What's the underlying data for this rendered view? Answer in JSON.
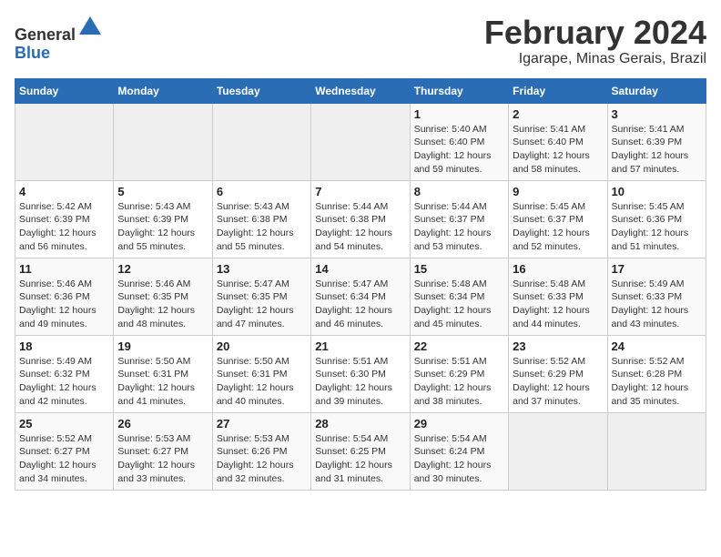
{
  "header": {
    "logo_line1": "General",
    "logo_line2": "Blue",
    "title": "February 2024",
    "subtitle": "Igarape, Minas Gerais, Brazil"
  },
  "weekdays": [
    "Sunday",
    "Monday",
    "Tuesday",
    "Wednesday",
    "Thursday",
    "Friday",
    "Saturday"
  ],
  "weeks": [
    [
      {
        "day": "",
        "info": ""
      },
      {
        "day": "",
        "info": ""
      },
      {
        "day": "",
        "info": ""
      },
      {
        "day": "",
        "info": ""
      },
      {
        "day": "1",
        "info": "Sunrise: 5:40 AM\nSunset: 6:40 PM\nDaylight: 12 hours\nand 59 minutes."
      },
      {
        "day": "2",
        "info": "Sunrise: 5:41 AM\nSunset: 6:40 PM\nDaylight: 12 hours\nand 58 minutes."
      },
      {
        "day": "3",
        "info": "Sunrise: 5:41 AM\nSunset: 6:39 PM\nDaylight: 12 hours\nand 57 minutes."
      }
    ],
    [
      {
        "day": "4",
        "info": "Sunrise: 5:42 AM\nSunset: 6:39 PM\nDaylight: 12 hours\nand 56 minutes."
      },
      {
        "day": "5",
        "info": "Sunrise: 5:43 AM\nSunset: 6:39 PM\nDaylight: 12 hours\nand 55 minutes."
      },
      {
        "day": "6",
        "info": "Sunrise: 5:43 AM\nSunset: 6:38 PM\nDaylight: 12 hours\nand 55 minutes."
      },
      {
        "day": "7",
        "info": "Sunrise: 5:44 AM\nSunset: 6:38 PM\nDaylight: 12 hours\nand 54 minutes."
      },
      {
        "day": "8",
        "info": "Sunrise: 5:44 AM\nSunset: 6:37 PM\nDaylight: 12 hours\nand 53 minutes."
      },
      {
        "day": "9",
        "info": "Sunrise: 5:45 AM\nSunset: 6:37 PM\nDaylight: 12 hours\nand 52 minutes."
      },
      {
        "day": "10",
        "info": "Sunrise: 5:45 AM\nSunset: 6:36 PM\nDaylight: 12 hours\nand 51 minutes."
      }
    ],
    [
      {
        "day": "11",
        "info": "Sunrise: 5:46 AM\nSunset: 6:36 PM\nDaylight: 12 hours\nand 49 minutes."
      },
      {
        "day": "12",
        "info": "Sunrise: 5:46 AM\nSunset: 6:35 PM\nDaylight: 12 hours\nand 48 minutes."
      },
      {
        "day": "13",
        "info": "Sunrise: 5:47 AM\nSunset: 6:35 PM\nDaylight: 12 hours\nand 47 minutes."
      },
      {
        "day": "14",
        "info": "Sunrise: 5:47 AM\nSunset: 6:34 PM\nDaylight: 12 hours\nand 46 minutes."
      },
      {
        "day": "15",
        "info": "Sunrise: 5:48 AM\nSunset: 6:34 PM\nDaylight: 12 hours\nand 45 minutes."
      },
      {
        "day": "16",
        "info": "Sunrise: 5:48 AM\nSunset: 6:33 PM\nDaylight: 12 hours\nand 44 minutes."
      },
      {
        "day": "17",
        "info": "Sunrise: 5:49 AM\nSunset: 6:33 PM\nDaylight: 12 hours\nand 43 minutes."
      }
    ],
    [
      {
        "day": "18",
        "info": "Sunrise: 5:49 AM\nSunset: 6:32 PM\nDaylight: 12 hours\nand 42 minutes."
      },
      {
        "day": "19",
        "info": "Sunrise: 5:50 AM\nSunset: 6:31 PM\nDaylight: 12 hours\nand 41 minutes."
      },
      {
        "day": "20",
        "info": "Sunrise: 5:50 AM\nSunset: 6:31 PM\nDaylight: 12 hours\nand 40 minutes."
      },
      {
        "day": "21",
        "info": "Sunrise: 5:51 AM\nSunset: 6:30 PM\nDaylight: 12 hours\nand 39 minutes."
      },
      {
        "day": "22",
        "info": "Sunrise: 5:51 AM\nSunset: 6:29 PM\nDaylight: 12 hours\nand 38 minutes."
      },
      {
        "day": "23",
        "info": "Sunrise: 5:52 AM\nSunset: 6:29 PM\nDaylight: 12 hours\nand 37 minutes."
      },
      {
        "day": "24",
        "info": "Sunrise: 5:52 AM\nSunset: 6:28 PM\nDaylight: 12 hours\nand 35 minutes."
      }
    ],
    [
      {
        "day": "25",
        "info": "Sunrise: 5:52 AM\nSunset: 6:27 PM\nDaylight: 12 hours\nand 34 minutes."
      },
      {
        "day": "26",
        "info": "Sunrise: 5:53 AM\nSunset: 6:27 PM\nDaylight: 12 hours\nand 33 minutes."
      },
      {
        "day": "27",
        "info": "Sunrise: 5:53 AM\nSunset: 6:26 PM\nDaylight: 12 hours\nand 32 minutes."
      },
      {
        "day": "28",
        "info": "Sunrise: 5:54 AM\nSunset: 6:25 PM\nDaylight: 12 hours\nand 31 minutes."
      },
      {
        "day": "29",
        "info": "Sunrise: 5:54 AM\nSunset: 6:24 PM\nDaylight: 12 hours\nand 30 minutes."
      },
      {
        "day": "",
        "info": ""
      },
      {
        "day": "",
        "info": ""
      }
    ]
  ]
}
